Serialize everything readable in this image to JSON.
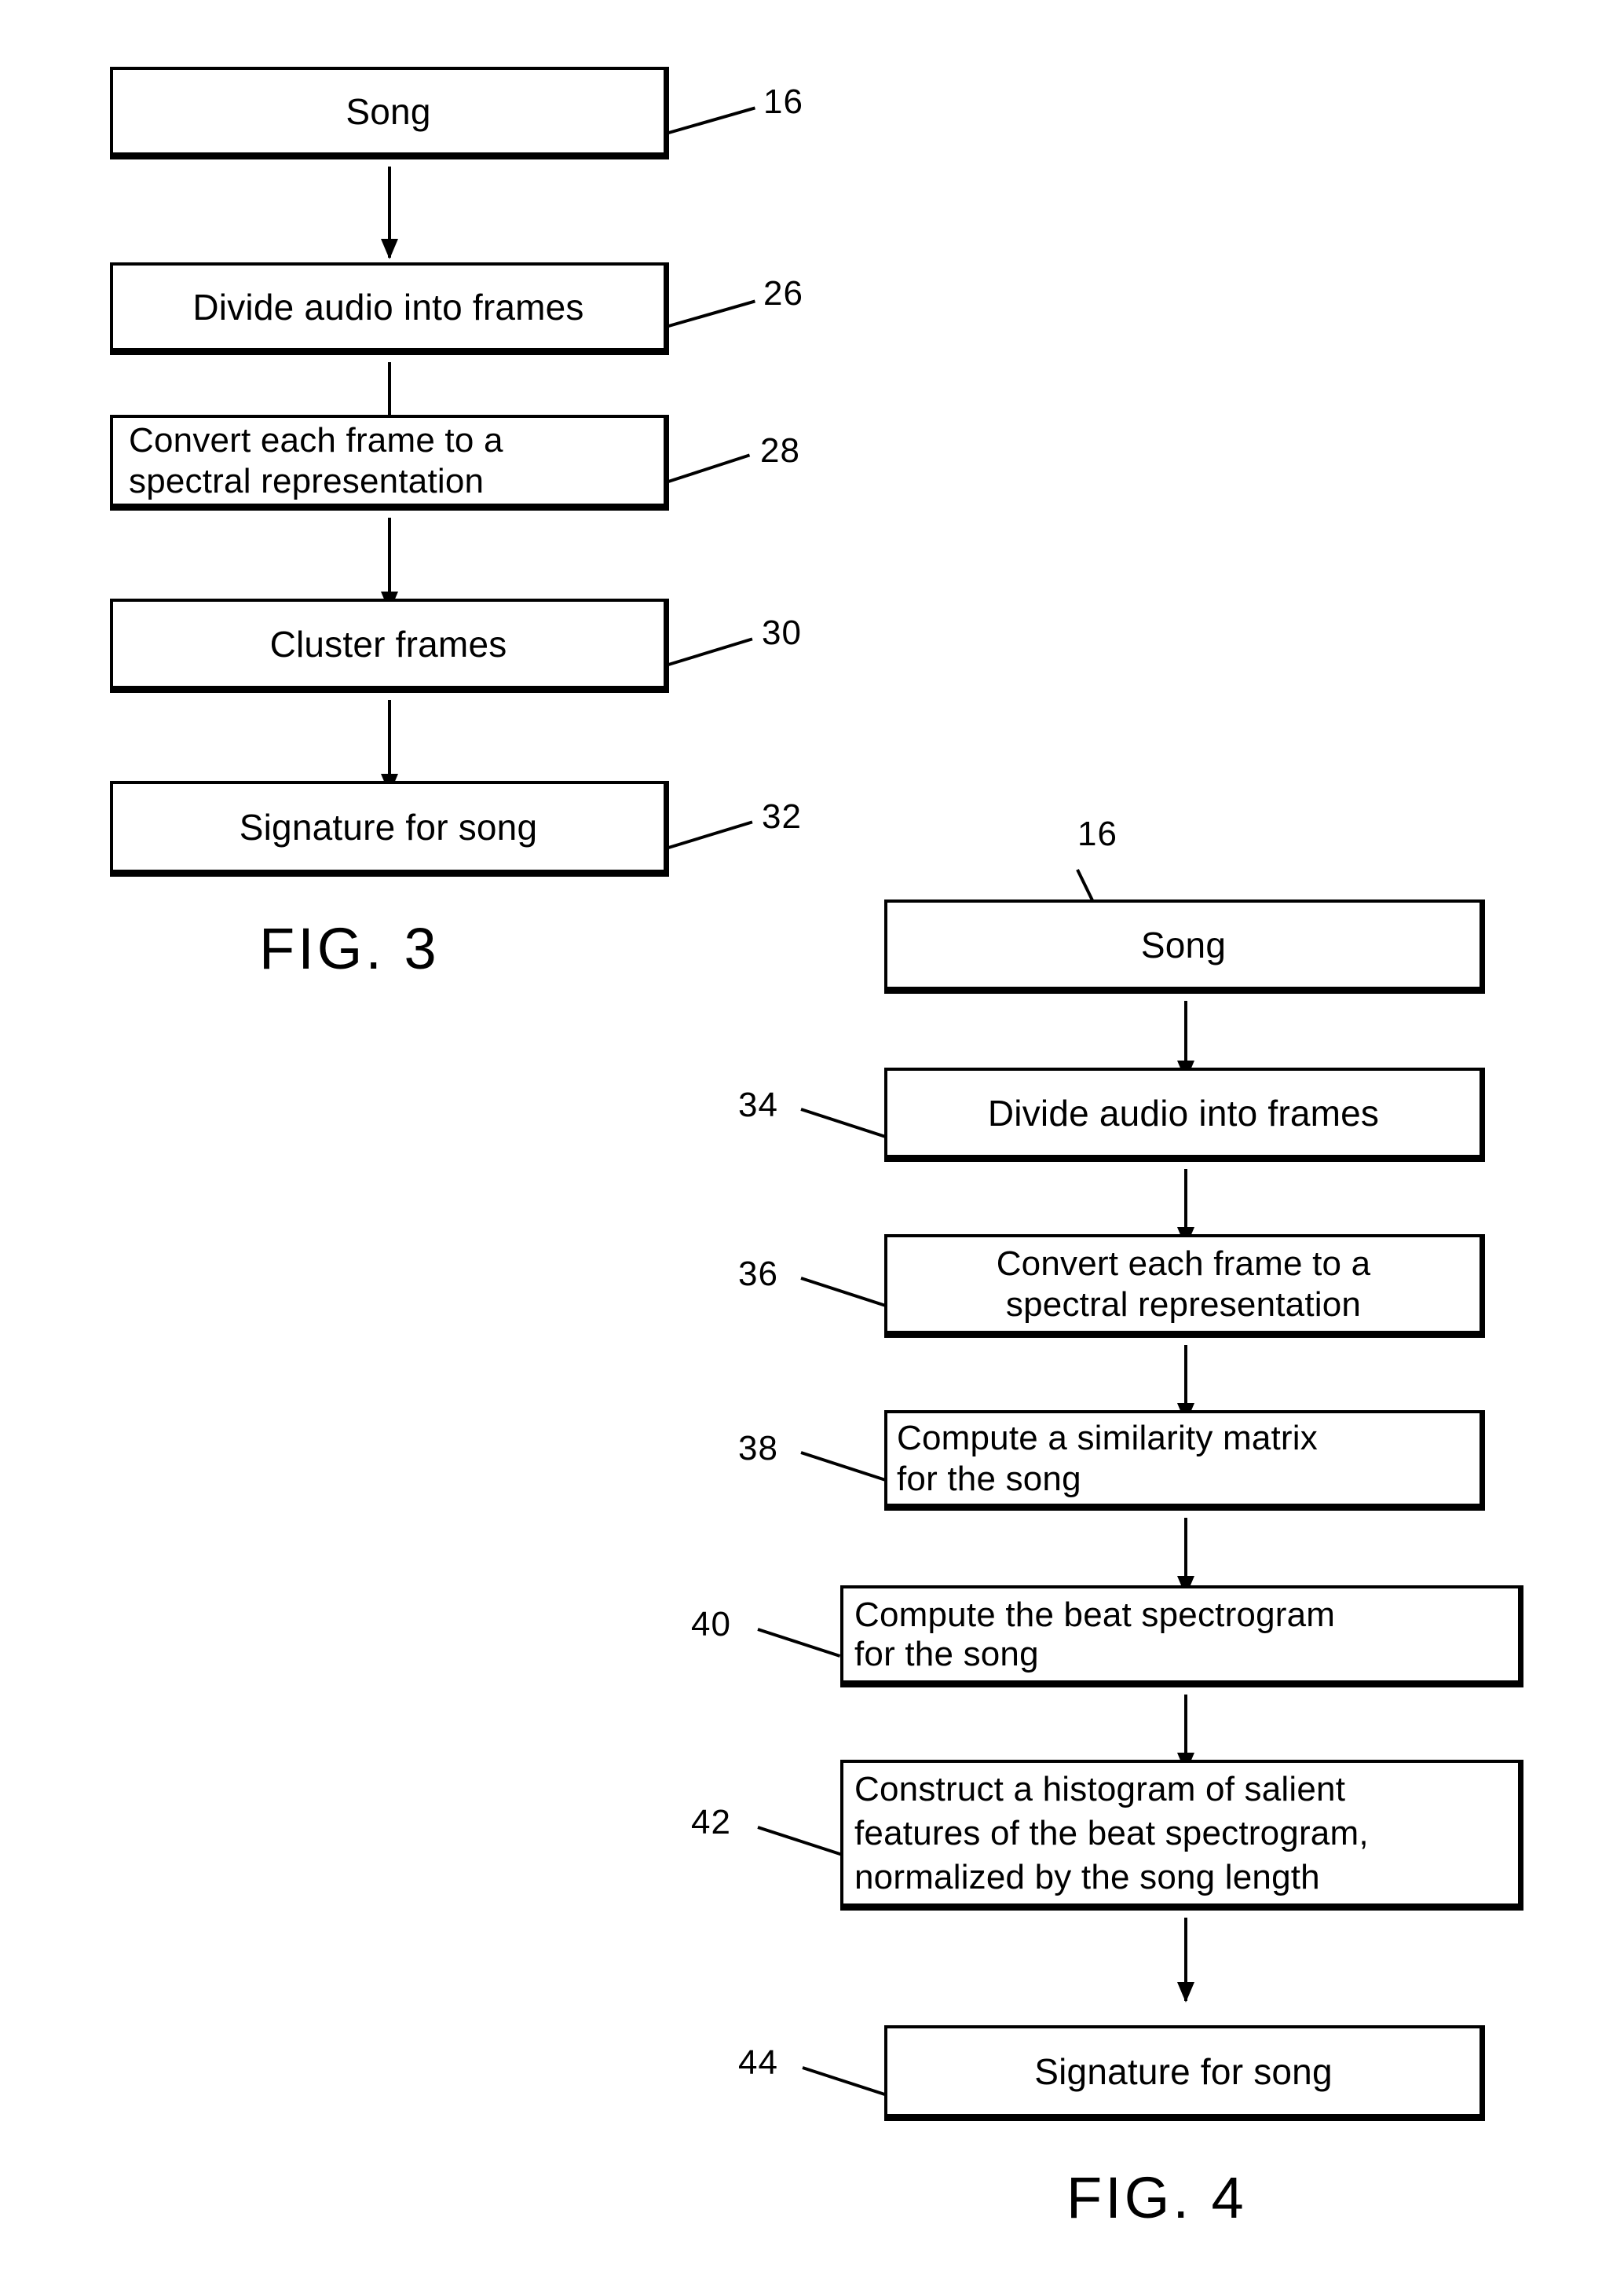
{
  "document": {
    "type": "patent-drawing-sheet",
    "figures": [
      {
        "id": "fig3",
        "caption": "FIG. 3",
        "numeral_side": "right",
        "steps": [
          {
            "ref": "16",
            "label": "Song"
          },
          {
            "ref": "26",
            "label": "Divide audio into frames"
          },
          {
            "ref": "28",
            "label": "Convert each frame to a\nspectral representation"
          },
          {
            "ref": "30",
            "label": "Cluster frames"
          },
          {
            "ref": "32",
            "label": "Signature for song"
          }
        ]
      },
      {
        "id": "fig4",
        "caption": "FIG. 4",
        "numeral_side": "left",
        "steps": [
          {
            "ref": "16",
            "label": "Song"
          },
          {
            "ref": "34",
            "label": "Divide audio into frames"
          },
          {
            "ref": "36",
            "label": "Convert each frame to a\nspectral representation"
          },
          {
            "ref": "38",
            "label": "Compute a similarity matrix\nfor the song"
          },
          {
            "ref": "40",
            "label": "Compute the beat spectrogram\nfor the song"
          },
          {
            "ref": "42",
            "label": "Construct a histogram of salient\nfeatures of the beat spectrogram,\nnormalized by the song length"
          },
          {
            "ref": "44",
            "label": "Signature for song"
          }
        ]
      }
    ],
    "colors": {
      "ink": "#000000",
      "paper": "#ffffff"
    }
  }
}
